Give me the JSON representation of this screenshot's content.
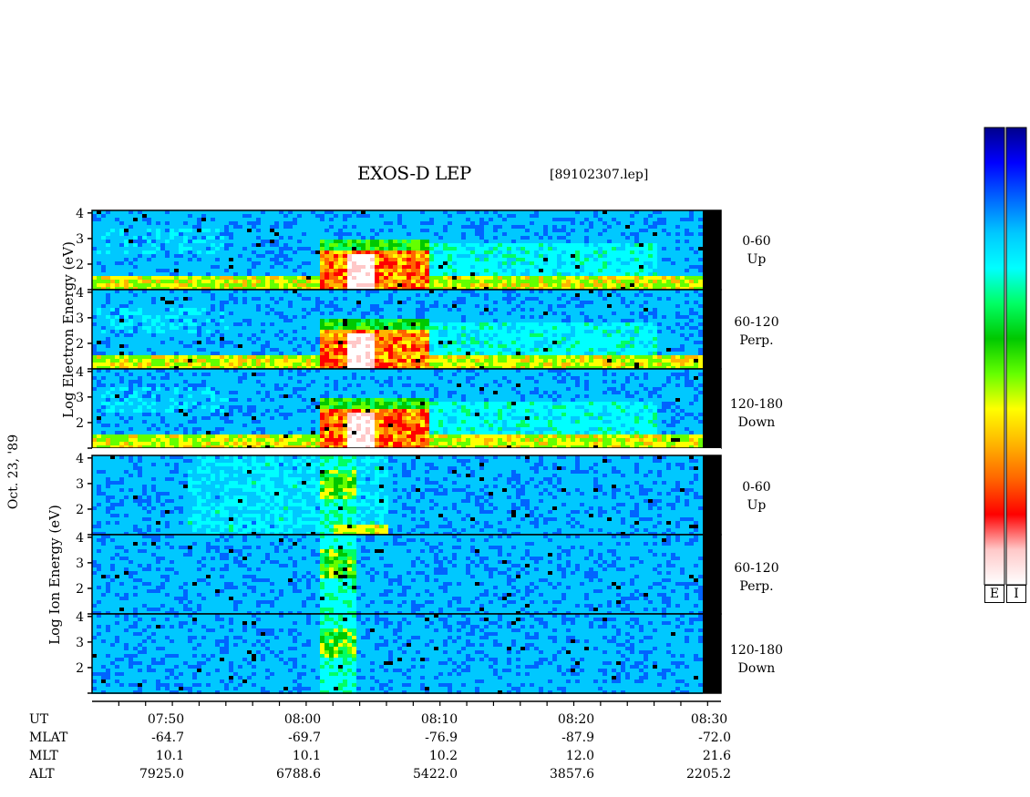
{
  "header": {
    "title": "EXOS-D LEP",
    "filename": "[89102307.lep]"
  },
  "left_axis": {
    "electron_label": "Log  Electron  Energy (eV)",
    "ion_label": "Log  Ion  Energy (eV)",
    "date_label": "Oct. 23, '89"
  },
  "chart_data": {
    "type": "heatmap",
    "title": "EXOS-D LEP",
    "x_axis": {
      "label": "UT",
      "range": [
        "07:43",
        "08:30"
      ],
      "ticks": [
        "07:50",
        "08:00",
        "08:10",
        "08:20",
        "08:30"
      ]
    },
    "y_axis": {
      "electron_label": "Log Electron Energy (eV)",
      "ion_label": "Log Ion Energy (eV)",
      "ticks": [
        "1",
        "2",
        "3",
        "4"
      ],
      "range": [
        1,
        4.1
      ]
    },
    "panels": [
      {
        "group": "electron",
        "pitch_angle": "0-60",
        "direction": "Up"
      },
      {
        "group": "electron",
        "pitch_angle": "60-120",
        "direction": "Perp."
      },
      {
        "group": "electron",
        "pitch_angle": "120-180",
        "direction": "Down"
      },
      {
        "group": "ion",
        "pitch_angle": "0-60",
        "direction": "Up"
      },
      {
        "group": "ion",
        "pitch_angle": "60-120",
        "direction": "Perp."
      },
      {
        "group": "ion",
        "pitch_angle": "120-180",
        "direction": "Down"
      }
    ],
    "orbit_table": {
      "UT": [
        "07:50",
        "08:00",
        "08:10",
        "08:20",
        "08:30"
      ],
      "MLAT": [
        "-64.7",
        "-69.7",
        "-76.9",
        "-87.9",
        "-72.0"
      ],
      "MLT": [
        "10.1",
        "10.1",
        "10.2",
        "12.0",
        "21.6"
      ],
      "ALT": [
        "7925.0",
        "6788.6",
        "5422.0",
        "3857.6",
        "2205.2"
      ]
    },
    "colorbars": [
      "E",
      "I"
    ],
    "colorscale": [
      "#00008c",
      "#0000ff",
      "#0064ff",
      "#00c8ff",
      "#00ffff",
      "#00ff64",
      "#00c800",
      "#64ff00",
      "#ffff00",
      "#ffb400",
      "#ff6400",
      "#ff0000",
      "#ffc8c8",
      "#ffffff"
    ]
  },
  "row_labels": [
    "UT",
    "MLAT",
    "MLT",
    "ALT"
  ]
}
